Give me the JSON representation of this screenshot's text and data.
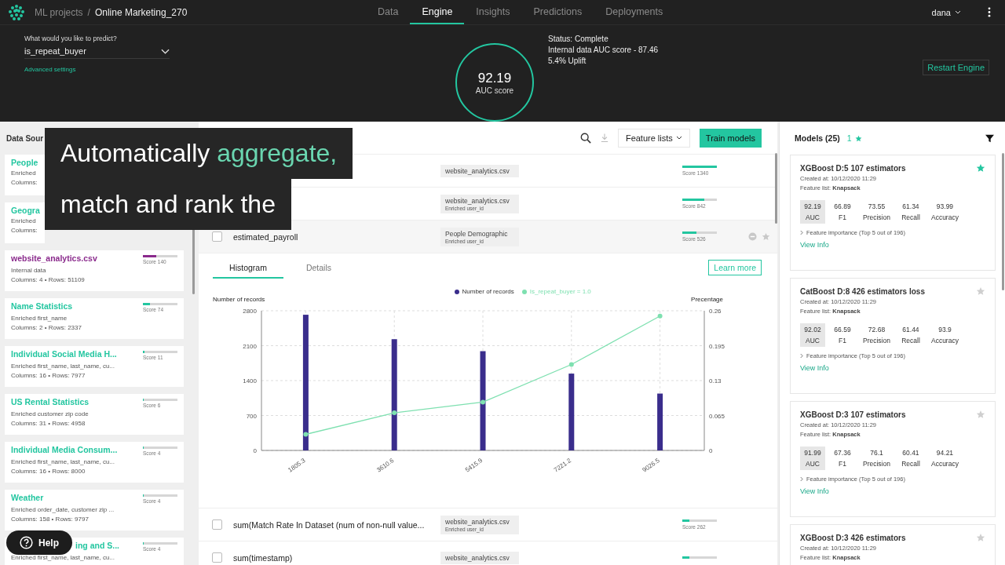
{
  "topbar": {
    "breadcrumb": [
      {
        "label": "ML projects"
      },
      {
        "label": "Online Marketing_270"
      }
    ],
    "separator": "/",
    "nav": [
      {
        "label": "Data",
        "selected": false
      },
      {
        "label": "Engine",
        "selected": true
      },
      {
        "label": "Insights",
        "selected": false
      },
      {
        "label": "Predictions",
        "selected": false
      },
      {
        "label": "Deployments",
        "selected": false
      }
    ],
    "user": "dana"
  },
  "engine": {
    "predict_label": "What would you like to predict?",
    "target": "is_repeat_buyer",
    "advanced_link": "Advanced settings",
    "score": "92.19",
    "score_label": "AUC score",
    "status": [
      "Status: Complete",
      "Internal data AUC score - 87.46",
      "5.4% Uplift"
    ],
    "restart_button": "Restart Engine"
  },
  "sources": {
    "title": "Data Sour",
    "items": [
      {
        "title": "People",
        "subtitle": "Enriched",
        "columns": "Columns:",
        "color": "#23c6a0"
      },
      {
        "title": "Geogra",
        "subtitle": "Enriched",
        "columns": "Columns:",
        "color": "#23c6a0"
      },
      {
        "title": "website_analytics.csv",
        "subtitle": "Internal data",
        "columns": "Columns: 4 • Rows: 51109",
        "score": "Score 140",
        "level": 0.38,
        "color": "#8a2a8c"
      },
      {
        "title": "Name Statistics",
        "subtitle": "Enriched first_name",
        "columns": "Columns: 2 • Rows: 2337",
        "score": "Score 74",
        "level": 0.2,
        "color": "#23c6a0"
      },
      {
        "title": "Individual Social Media H...",
        "subtitle": "Enriched first_name, last_name, cu...",
        "columns": "Columns: 16 • Rows: 7977",
        "score": "Score 11",
        "level": 0.04,
        "color": "#23c6a0"
      },
      {
        "title": "US Rental Statistics",
        "subtitle": "Enriched customer zip code",
        "columns": "Columns: 31 • Rows: 4958",
        "score": "Score 6",
        "level": 0.03,
        "color": "#23c6a0"
      },
      {
        "title": "Individual Media Consum...",
        "subtitle": "Enriched first_name, last_name, cu...",
        "columns": "Columns: 16 • Rows: 8000",
        "score": "Score 4",
        "level": 0.02,
        "color": "#23c6a0"
      },
      {
        "title": "Weather",
        "subtitle": "Enriched order_date, customer zip ...",
        "columns": "Columns: 158 • Rows: 9797",
        "score": "Score 4",
        "level": 0.02,
        "color": "#23c6a0"
      },
      {
        "title": "ing and S...",
        "subtitle": "Enriched first_name, last_name, cu...",
        "score": "Score 4",
        "level": 0.02,
        "color": "#23c6a0"
      }
    ]
  },
  "features": {
    "toolbar": {
      "lists_button": "Feature lists",
      "train_button": "Train models"
    },
    "rows": [
      {
        "source": "website_analytics.csv",
        "score": "Score 1340",
        "level": 1.0,
        "expanded": false
      },
      {
        "source": "website_analytics.csv",
        "source_sub": "Enriched user_id",
        "score": "Score 842",
        "level": 0.63,
        "expanded": false
      },
      {
        "name": "estimated_payroll",
        "checked": false,
        "source": "People Demographic",
        "source_sub": "Enriched user_id",
        "score": "Score 526",
        "level": 0.4,
        "expanded": true,
        "detail": {
          "tabs": [
            {
              "label": "Histogram",
              "selected": true
            },
            {
              "label": "Details",
              "selected": false
            }
          ],
          "learn_more": "Learn more",
          "chart_data": {
            "type": "bar",
            "ylabel": "Number of records",
            "y2label": "Precentage",
            "grid": true,
            "legend": true,
            "categories": [
              "1805.3",
              "3610.6",
              "5415.9",
              "7221.2",
              "9026.5"
            ],
            "ylim": [
              0,
              2800
            ],
            "yticks": [
              0,
              700,
              1400,
              2100,
              2800
            ],
            "y2lim": [
              0,
              0.26
            ],
            "y2ticks": [
              0,
              0.065,
              0.13,
              0.195,
              0.26
            ],
            "series": [
              {
                "name": "Number of records",
                "color": "#3a2d8c",
                "type": "bar",
                "values": [
                  2720,
                  2230,
                  1990,
                  1540,
                  1140
                ]
              },
              {
                "name": "Is_repeat_buyer = 1.0",
                "color": "#7ee0b0",
                "type": "line",
                "axis": "y2",
                "marker": true,
                "values": [
                  0.03,
                  0.07,
                  0.09,
                  0.16,
                  0.25
                ]
              }
            ]
          }
        }
      },
      {
        "name": "sum(Match Rate In Dataset (num of non-null value...",
        "checked": false,
        "source": "website_analytics.csv",
        "source_sub": "Enriched user_id",
        "score": "Score 262",
        "level": 0.2,
        "expanded": false
      },
      {
        "name": "sum(timestamp)",
        "checked": false,
        "source": "website_analytics.csv",
        "level": 0.2,
        "expanded": false
      }
    ]
  },
  "models": {
    "title": "Models (25)",
    "starred_count": "1",
    "cards": [
      {
        "title": "XGBoost D:5 107 estimators",
        "starred": true,
        "created": "Created at: 10/12/2020 11:29",
        "feature_list_label": "Feature list:",
        "feature_list": "Knapsack",
        "metrics": [
          {
            "value": "92.19",
            "label": "AUC",
            "selected": true
          },
          {
            "value": "66.89",
            "label": "F1",
            "selected": false
          },
          {
            "value": "73.55",
            "label": "Precision",
            "selected": false
          },
          {
            "value": "61.34",
            "label": "Recall",
            "selected": false
          },
          {
            "value": "93.99",
            "label": "Accuracy",
            "selected": false
          }
        ],
        "importance": "Feature importance (Top 5 out of 196)",
        "view_info": "View Info"
      },
      {
        "title": "CatBoost D:8 426 estimators loss",
        "starred": false,
        "created": "Created at: 10/12/2020 11:29",
        "feature_list_label": "Feature list:",
        "feature_list": "Knapsack",
        "metrics": [
          {
            "value": "92.02",
            "label": "AUC",
            "selected": true
          },
          {
            "value": "66.59",
            "label": "F1",
            "selected": false
          },
          {
            "value": "72.68",
            "label": "Precision",
            "selected": false
          },
          {
            "value": "61.44",
            "label": "Recall",
            "selected": false
          },
          {
            "value": "93.9",
            "label": "Accuracy",
            "selected": false
          }
        ],
        "importance": "Feature importance (Top 5 out of 196)",
        "view_info": "View Info"
      },
      {
        "title": "XGBoost D:3 107 estimators",
        "starred": false,
        "created": "Created at: 10/12/2020 11:29",
        "feature_list_label": "Feature list:",
        "feature_list": "Knapsack",
        "metrics": [
          {
            "value": "91.99",
            "label": "AUC",
            "selected": true
          },
          {
            "value": "67.36",
            "label": "F1",
            "selected": false
          },
          {
            "value": "76.1",
            "label": "Precision",
            "selected": false
          },
          {
            "value": "60.41",
            "label": "Recall",
            "selected": false
          },
          {
            "value": "94.21",
            "label": "Accuracy",
            "selected": false
          }
        ],
        "importance": "Feature importance (Top 5 out of 196)",
        "view_info": "View Info"
      },
      {
        "title": "XGBoost D:3 426 estimators",
        "starred": false,
        "created": "Created at: 10/12/2020 11:29",
        "feature_list_label": "Feature list:",
        "feature_list": "Knapsack"
      }
    ]
  },
  "help_button": "Help",
  "caption": {
    "lines": [
      {
        "parts": [
          {
            "text": "Automatically",
            "highlight": false
          },
          {
            "text": "aggregate,",
            "highlight": true
          }
        ]
      },
      {
        "parts": [
          {
            "text": "match and rank the",
            "highlight": false
          }
        ]
      }
    ]
  }
}
